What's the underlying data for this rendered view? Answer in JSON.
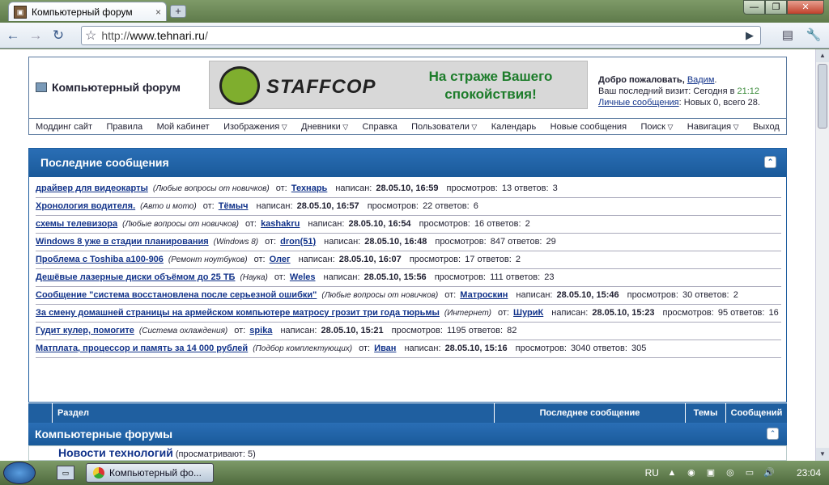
{
  "browser": {
    "tab_title": "Компьютерный форум",
    "tab_close": "×",
    "new_tab": "+",
    "url_scheme": "http://",
    "url_host": "www.tehnari.ru",
    "url_path": "/"
  },
  "header": {
    "logo_text": "Компьютерный форум",
    "banner_brand": "STAFFCOP",
    "banner_slogan": "На страже Вашего спокойствия!",
    "welcome_prefix": "Добро пожаловать, ",
    "username": "Вадим",
    "welcome_suffix": ".",
    "last_visit": "Ваш последний визит: Сегодня в ",
    "last_visit_time": "21:12",
    "pm_link": "Личные сообщения",
    "pm_stats": ": Новых 0, всего 28."
  },
  "nav": {
    "items": [
      "Моддинг сайт",
      "Правила",
      "Мой кабинет",
      "Изображения",
      "Дневники",
      "Справка",
      "Пользователи",
      "Календарь",
      "Новые сообщения",
      "Поиск",
      "Навигация",
      "Выход"
    ]
  },
  "latest": {
    "heading": "Последние сообщения",
    "label_from": "от:",
    "label_posted": "написан:",
    "label_views": "просмотров:",
    "label_replies": "ответов:",
    "posts": [
      {
        "title": "драйвер для видеокарты",
        "forum": "(Любые вопросы от новичков)",
        "author": "Технарь",
        "date": "28.05.10, 16:59",
        "views": "13",
        "replies": "3"
      },
      {
        "title": "Хронология водителя.",
        "forum": "(Авто и мото)",
        "author": "Тёмыч",
        "date": "28.05.10, 16:57",
        "views": "22",
        "replies": "6"
      },
      {
        "title": "схемы телевизора",
        "forum": "(Любые вопросы от новичков)",
        "author": "kashakru",
        "date": "28.05.10, 16:54",
        "views": "16",
        "replies": "2"
      },
      {
        "title": "Windows 8 уже в стадии планирования",
        "forum": "(Windows 8)",
        "author": "dron(51)",
        "date": "28.05.10, 16:48",
        "views": "847",
        "replies": "29"
      },
      {
        "title": "Проблема с Toshiba a100-906",
        "forum": "(Ремонт ноутбуков)",
        "author": "Олег",
        "date": "28.05.10, 16:07",
        "views": "17",
        "replies": "2"
      },
      {
        "title": "Дешёвые лазерные диски объёмом до 25 ТБ",
        "forum": "(Наука)",
        "author": "Weles",
        "date": "28.05.10, 15:56",
        "views": "111",
        "replies": "23"
      },
      {
        "title": "Сообщение \"система восстановлена после серьезной ошибки\"",
        "forum": "(Любые вопросы от новичков)",
        "author": "Матроскин",
        "date": "28.05.10, 15:46",
        "views": "30",
        "replies": "2"
      },
      {
        "title": "За смену домашней страницы на армейском компьютере матросу грозит три года тюрьмы",
        "forum": "(Интернет)",
        "author": "ШуриК",
        "date": "28.05.10, 15:23",
        "views": "95",
        "replies": "16"
      },
      {
        "title": "Гудит кулер, помогите",
        "forum": "(Система охлаждения)",
        "author": "spika",
        "date": "28.05.10, 15:21",
        "views": "1195",
        "replies": "82"
      },
      {
        "title": "Матплата, процессор и память за 14 000 рублей",
        "forum": "(Подбор комплектующих)",
        "author": "Иван",
        "date": "28.05.10, 15:16",
        "views": "3040",
        "replies": "305"
      }
    ]
  },
  "forum_table": {
    "col_section": "Раздел",
    "col_last": "Последнее сообщение",
    "col_topics": "Темы",
    "col_posts": "Сообщений",
    "category": "Компьютерные форумы",
    "first_forum": "Новости технологий",
    "first_forum_sub": " (просматривают: 5)"
  },
  "taskbar": {
    "window_button": "Компьютерный фо...",
    "lang": "RU",
    "time": "23:04"
  }
}
